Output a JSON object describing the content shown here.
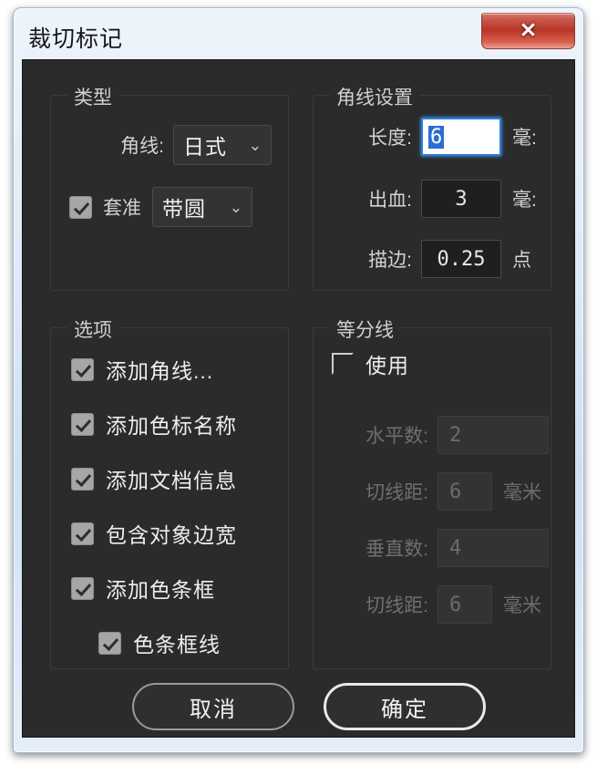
{
  "window": {
    "title": "裁切标记",
    "close_label": "✕"
  },
  "type_group": {
    "title": "类型",
    "corner_label": "角线:",
    "corner_value": "日式",
    "registration_label": "套准",
    "registration_checked": true,
    "registration_value": "带圆",
    "chevron": "⌄"
  },
  "corner_settings": {
    "title": "角线设置",
    "rows": [
      {
        "label": "长度:",
        "value": "6",
        "unit": "毫:",
        "state": "focused"
      },
      {
        "label": "出血:",
        "value": "3",
        "unit": "毫:",
        "state": "normal"
      },
      {
        "label": "描边:",
        "value": "0.25",
        "unit": "点",
        "state": "normal"
      }
    ]
  },
  "options_group": {
    "title": "选项",
    "items": [
      {
        "label": "添加角线...",
        "checked": true,
        "indent": false
      },
      {
        "label": "添加色标名称",
        "checked": true,
        "indent": false
      },
      {
        "label": "添加文档信息",
        "checked": true,
        "indent": false
      },
      {
        "label": "包含对象边宽",
        "checked": true,
        "indent": false
      },
      {
        "label": "添加色条框",
        "checked": true,
        "indent": false
      },
      {
        "label": "色条框线",
        "checked": true,
        "indent": true
      }
    ]
  },
  "divider_group": {
    "title": "等分线",
    "enable_label": "使用",
    "enable_checked": false,
    "rows": [
      {
        "label": "水平数:",
        "value": "2",
        "unit": "",
        "disabled": true
      },
      {
        "label": "切线距:",
        "value": "6",
        "unit": "毫米",
        "disabled": true
      },
      {
        "label": "垂直数:",
        "value": "4",
        "unit": "",
        "disabled": true
      },
      {
        "label": "切线距:",
        "value": "6",
        "unit": "毫米",
        "disabled": true
      }
    ]
  },
  "footer": {
    "cancel_label": "取消",
    "ok_label": "确定"
  },
  "colors": {
    "dialog_bg": "#2b2b2b",
    "frame": "#cfe0f3",
    "close_red": "#b63528",
    "focus_blue": "#2a7fd4"
  }
}
